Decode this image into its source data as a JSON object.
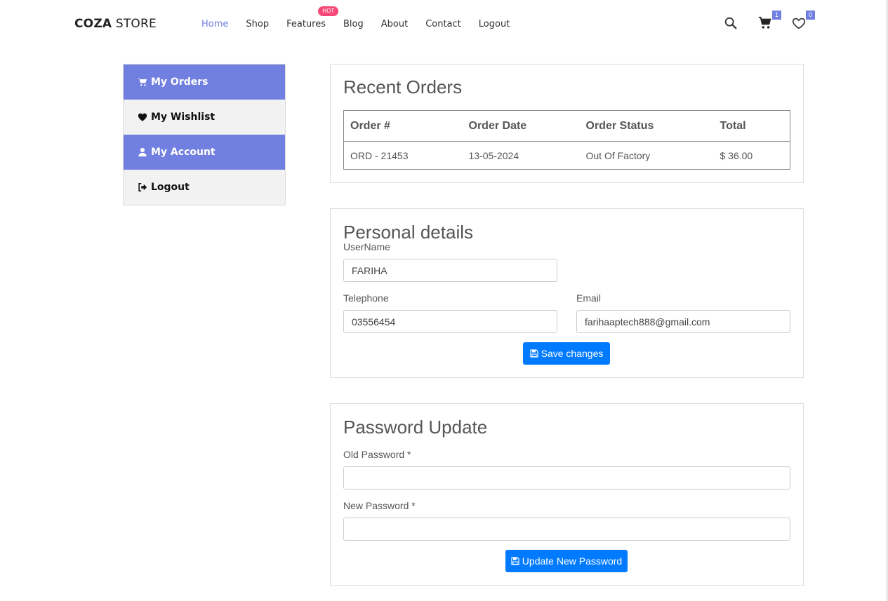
{
  "header": {
    "logo_bold": "COZA",
    "logo_light": "STORE",
    "nav": [
      "Home",
      "Shop",
      "Features",
      "Blog",
      "About",
      "Contact",
      "Logout"
    ],
    "hot_badge": "HOT",
    "cart_count": "1",
    "wishlist_count": "0"
  },
  "sidebar": {
    "items": [
      {
        "label": "My Orders",
        "icon": "cart-icon"
      },
      {
        "label": "My Wishlist",
        "icon": "heart-icon"
      },
      {
        "label": "My Account",
        "icon": "user-icon"
      },
      {
        "label": "Logout",
        "icon": "sign-out-icon"
      }
    ]
  },
  "orders": {
    "title": "Recent Orders",
    "columns": [
      "Order #",
      "Order Date",
      "Order Status",
      "Total"
    ],
    "rows": [
      [
        "ORD - 21453",
        "13-05-2024",
        "Out Of Factory",
        "$ 36.00"
      ]
    ]
  },
  "details": {
    "title": "Personal details",
    "username_label": "UserName",
    "username_value": "FARIHA",
    "telephone_label": "Telephone",
    "telephone_value": "03556454",
    "email_label": "Email",
    "email_value": "farihaaptech888@gmail.com",
    "save_label": "Save changes"
  },
  "password": {
    "title": "Password Update",
    "old_label": "Old Password *",
    "new_label": "New Password *",
    "update_label": "Update New Password"
  },
  "colors": {
    "accent": "#717fe0",
    "button": "#007bff",
    "hot": "#f74877"
  }
}
